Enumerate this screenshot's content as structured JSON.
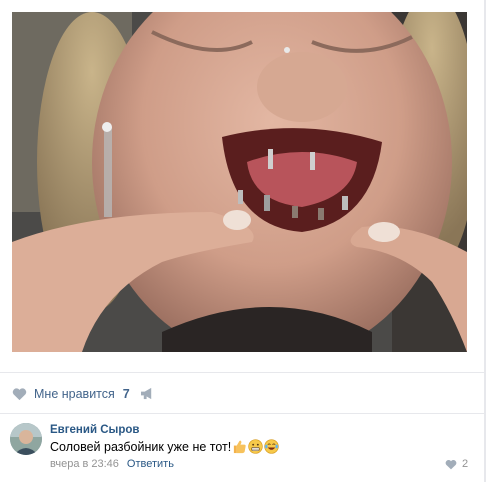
{
  "post": {
    "actions": {
      "like_label": "Мне нравится",
      "like_count": "7"
    }
  },
  "comment": {
    "author": "Евгений Сыров",
    "text": "Соловей разбойник уже не тот!",
    "emojis": [
      "thumbs-up-emoji",
      "grimacing-emoji",
      "laughing-tears-emoji"
    ],
    "time": "вчера в 23:46",
    "reply_label": "Ответить",
    "like_count": "2"
  },
  "colors": {
    "link": "#2a5885",
    "like_text": "#42648b",
    "icon_gray": "#a2adb9",
    "meta_gray": "#939393",
    "divider": "#e7e8ec"
  },
  "icons": {
    "like": "heart-icon",
    "share": "megaphone-icon",
    "comment_like": "heart-icon"
  }
}
